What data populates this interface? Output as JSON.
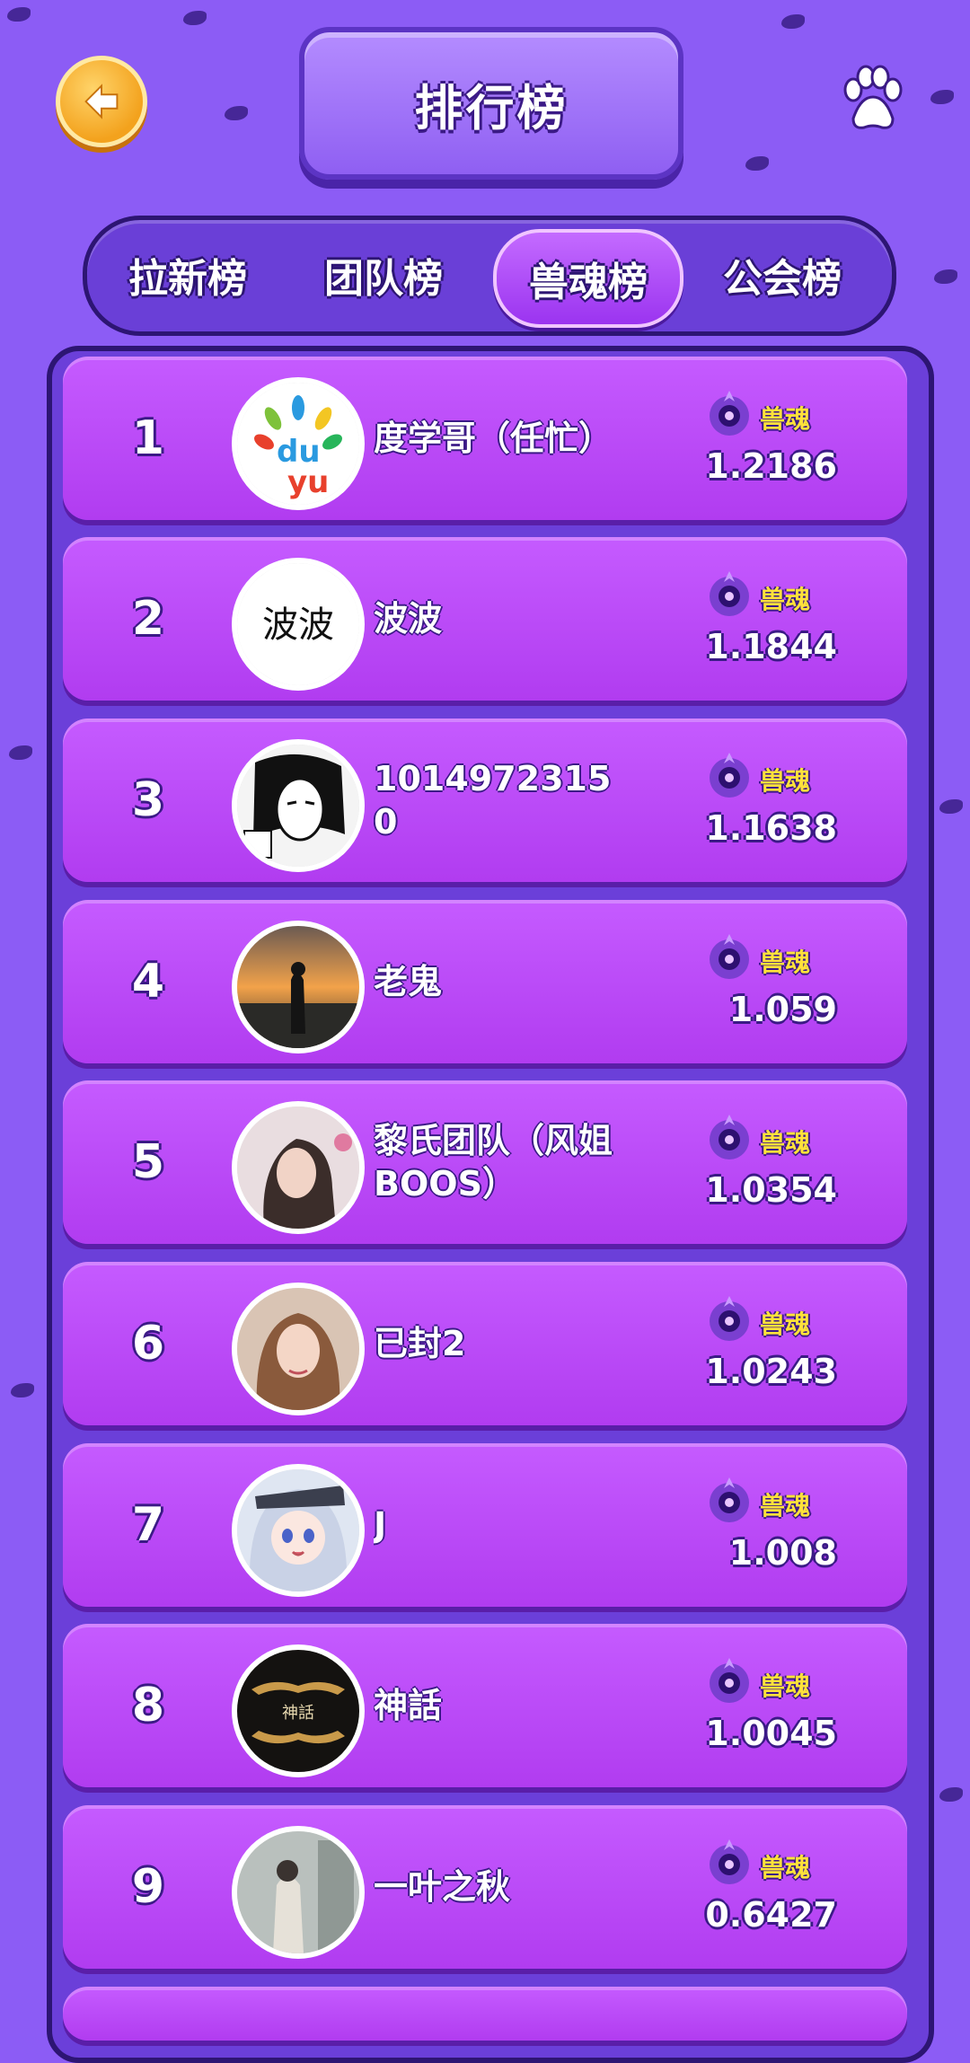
{
  "header": {
    "title": "排行榜",
    "back_icon": "arrow-left-icon",
    "settings_icon": "paw-icon"
  },
  "tabs": [
    {
      "label": "拉新榜",
      "active": false
    },
    {
      "label": "团队榜",
      "active": false
    },
    {
      "label": "兽魂榜",
      "active": true
    },
    {
      "label": "公会榜",
      "active": false
    }
  ],
  "colors": {
    "background": "#8c5cf5",
    "row": "#b13cf0",
    "accent_gold": "#ffe23a"
  },
  "score_label": "兽魂",
  "rows": [
    {
      "rank": "1",
      "name": "度学哥（任忙）",
      "score": "1.2186",
      "avatar": "duyu-logo"
    },
    {
      "rank": "2",
      "name": "波波",
      "score": "1.1844",
      "avatar": "text-avatar-bobo"
    },
    {
      "rank": "3",
      "name": "10149723150",
      "score": "1.1638",
      "avatar": "manga-portrait"
    },
    {
      "rank": "4",
      "name": "老鬼",
      "score": "1.059",
      "avatar": "sunset-silhouette"
    },
    {
      "rank": "5",
      "name": "黎氏团队（风姐BOOS）",
      "score": "1.0354",
      "avatar": "woman-photo"
    },
    {
      "rank": "6",
      "name": "已封2",
      "score": "1.0243",
      "avatar": "woman-photo"
    },
    {
      "rank": "7",
      "name": "J",
      "score": "1.008",
      "avatar": "anime-girl"
    },
    {
      "rank": "8",
      "name": "神話",
      "score": "1.0045",
      "avatar": "dark-emblem"
    },
    {
      "rank": "9",
      "name": "一叶之秋",
      "score": "0.6427",
      "avatar": "street-photo"
    }
  ]
}
